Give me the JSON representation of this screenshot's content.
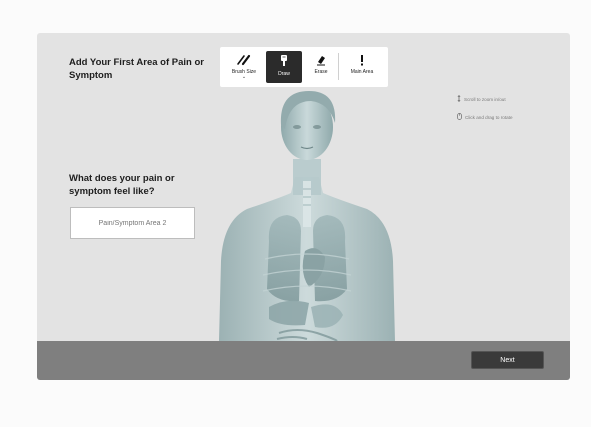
{
  "panel": {
    "title": "Add Your First Area of Pain or Symptom",
    "question": "What does your pain or symptom feel like?",
    "area_input": {
      "value": "",
      "placeholder": "Pain/Symptom Area 2"
    }
  },
  "toolbar": {
    "tools": [
      {
        "label": "Brush Size",
        "icon": "brush-size-icon",
        "active": false
      },
      {
        "label": "Draw",
        "icon": "draw-icon",
        "active": true
      },
      {
        "label": "Erase",
        "icon": "erase-icon",
        "active": false
      },
      {
        "label": "Main Area",
        "icon": "exclamation-icon",
        "active": false
      }
    ]
  },
  "hints": {
    "zoom": "Scroll to zoom in/out",
    "rotate": "Click and drag to rotate"
  },
  "footer": {
    "next_label": "Next"
  },
  "colors": {
    "panel_bg": "#e3e3e3",
    "active_tool_bg": "#2b2b2b",
    "bottom_bar": "#767676",
    "next_button": "#3a3a3a",
    "anatomy_tint": "#a9c4c6"
  }
}
